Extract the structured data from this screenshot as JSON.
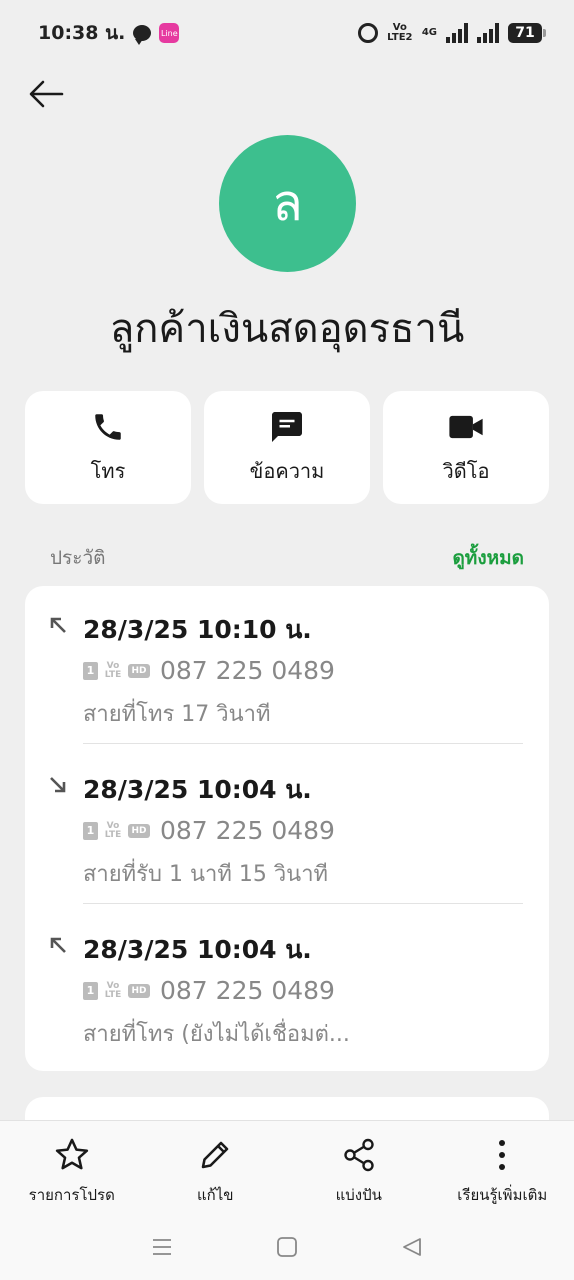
{
  "status_bar": {
    "time": "10:38 น.",
    "app_badge": "Line",
    "volte": "Vo LTE2",
    "network": "4G",
    "battery": "71"
  },
  "contact": {
    "avatar_letter": "ล",
    "name": "ลูกค้าเงินสดอุดรธานี",
    "avatar_color": "#3dbf8e"
  },
  "actions": [
    {
      "label": "โทร",
      "icon": "phone-icon"
    },
    {
      "label": "ข้อความ",
      "icon": "message-icon"
    },
    {
      "label": "วิดีโอ",
      "icon": "video-icon"
    }
  ],
  "history": {
    "title": "ประวัติ",
    "view_all": "ดูทั้งหมด",
    "accent": "#1b9e3e",
    "entries": [
      {
        "direction": "outgoing",
        "time": "28/3/25 10:10 น.",
        "sim": "1",
        "volte": "Vo LTE",
        "hd": "HD",
        "number": "087 225 0489",
        "status": "สายที่โทร  17 วินาที"
      },
      {
        "direction": "incoming",
        "time": "28/3/25 10:04 น.",
        "sim": "1",
        "volte": "Vo LTE",
        "hd": "HD",
        "number": "087 225 0489",
        "status": "สายที่รับ  1 นาที 15 วินาที"
      },
      {
        "direction": "outgoing",
        "time": "28/3/25 10:04 น.",
        "sim": "1",
        "volte": "Vo LTE",
        "hd": "HD",
        "number": "087 225 0489",
        "status": "สายที่โทร (ยังไม่ได้เชื่อมต่..."
      }
    ]
  },
  "toolbar": [
    {
      "label": "รายการโปรด",
      "icon": "star-icon"
    },
    {
      "label": "แก้ไข",
      "icon": "pencil-icon"
    },
    {
      "label": "แบ่งปัน",
      "icon": "share-icon"
    },
    {
      "label": "เรียนรู้เพิ่มเติม",
      "icon": "more-icon"
    }
  ]
}
